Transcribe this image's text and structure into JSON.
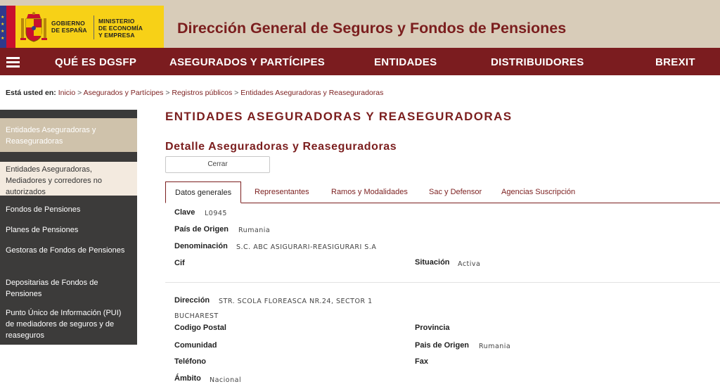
{
  "header": {
    "gov_line1": "GOBIERNO",
    "gov_line2": "DE ESPAÑA",
    "min_line1": "MINISTERIO",
    "min_line2": "DE ECONOMÍA",
    "min_line3": "Y EMPRESA",
    "site_title": "Dirección General de Seguros y Fondos de Pensiones"
  },
  "nav": {
    "items": [
      "QUÉ ES DGSFP",
      "ASEGURADOS Y PARTÍCIPES",
      "ENTIDADES",
      "DISTRIBUIDORES",
      "BREXIT"
    ]
  },
  "breadcrumb": {
    "lead": "Está usted en:",
    "items": [
      "Inicio",
      "Asegurados y Partícipes",
      "Registros públicos",
      "Entidades Aseguradoras y Reaseguradoras"
    ]
  },
  "sidebar": {
    "items": [
      "Entidades Aseguradoras y Reaseguradoras",
      "Entidades Aseguradoras, Mediadores y corredores no autorizados",
      "Fondos de Pensiones",
      "Planes de Pensiones",
      "Gestoras de Fondos de Pensiones",
      "Depositarias de Fondos de Pensiones",
      "Punto Único de Información (PUI) de mediadores de seguros y de reaseguros"
    ]
  },
  "main": {
    "title": "ENTIDADES ASEGURADORAS Y REASEGURADORAS",
    "subtitle": "Detalle Aseguradoras y Reaseguradoras",
    "close_label": "Cerrar",
    "tabs": [
      "Datos generales",
      "Representantes",
      "Ramos y Modalidades",
      "Sac y Defensor",
      "Agencias Suscripción"
    ]
  },
  "details": {
    "clave_label": "Clave",
    "clave_value": "L0945",
    "pais_label": "País de Origen",
    "pais_value": "Rumania",
    "denominacion_label": "Denominación",
    "denominacion_value": "S.C. ABC ASIGURARI-REASIGURARI S.A",
    "cif_label": "Cif",
    "situacion_label": "Situación",
    "situacion_value": "Activa",
    "direccion_label": "Dirección",
    "direccion_value": "STR. SCOLA FLOREASCA NR.24, SECTOR 1",
    "ciudad_value": "BUCHAREST",
    "codigo_postal_label": "Codigo Postal",
    "provincia_label": "Provincia",
    "comunidad_label": "Comunidad",
    "pais2_label": "Pais de Origen",
    "pais2_value": "Rumania",
    "telefono_label": "Teléfono",
    "fax_label": "Fax",
    "ambito_label": "Ámbito",
    "ambito_value": "Nacional"
  },
  "colors": {
    "brand": "#7b1c1f",
    "header_bg": "#d8ccb9",
    "sidebar_bg": "#3c3b3a",
    "sidebar_active": "#cfc2ab",
    "logo_yellow": "#f7d117"
  }
}
